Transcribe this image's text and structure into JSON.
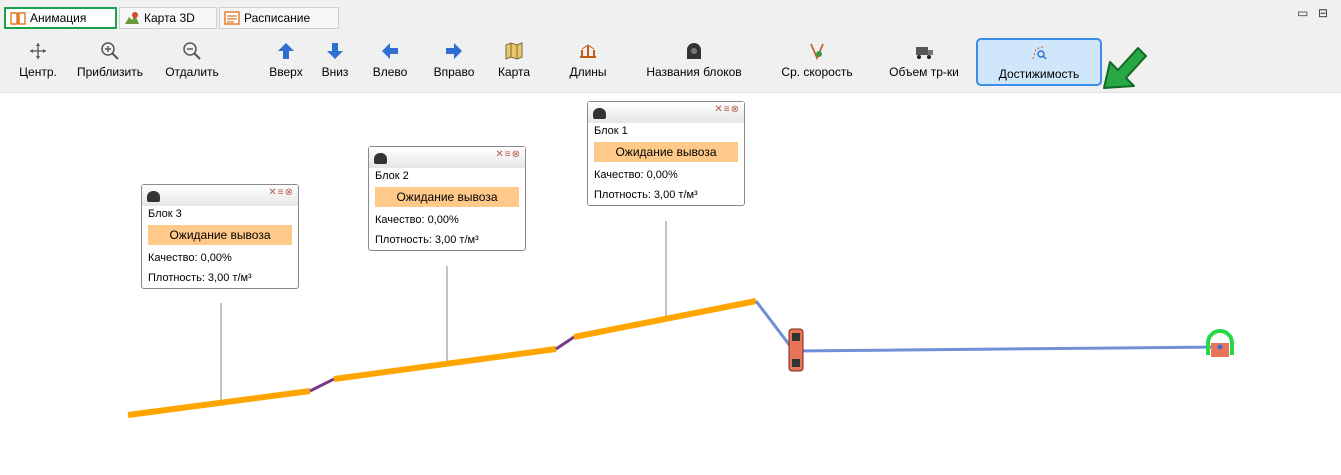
{
  "tabs": [
    {
      "label": "Анимация",
      "icon": "book-icon",
      "active": true
    },
    {
      "label": "Карта 3D",
      "icon": "map-3d-icon",
      "active": false
    },
    {
      "label": "Расписание",
      "icon": "schedule-icon",
      "active": false
    }
  ],
  "window_controls": {
    "minimize": "▭",
    "restore": "⊟"
  },
  "toolbar": [
    {
      "label": "Центр.",
      "icon": "move-center-icon"
    },
    {
      "label": "Приблизить",
      "icon": "zoom-in-icon"
    },
    {
      "label": "Отдалить",
      "icon": "zoom-out-icon"
    },
    {
      "label": "Вверх",
      "icon": "arrow-up-icon"
    },
    {
      "label": "Вниз",
      "icon": "arrow-down-icon"
    },
    {
      "label": "Влево",
      "icon": "arrow-left-icon"
    },
    {
      "label": "Вправо",
      "icon": "arrow-right-icon"
    },
    {
      "label": "Карта",
      "icon": "map-icon"
    },
    {
      "label": "Длины",
      "icon": "lengths-icon"
    },
    {
      "label": "Названия блоков",
      "icon": "block-names-icon"
    },
    {
      "label": "Ср. скорость",
      "icon": "avg-speed-icon"
    },
    {
      "label": "Объем тр-ки",
      "icon": "truck-volume-icon"
    },
    {
      "label": "Достижимость",
      "icon": "reachability-icon",
      "active": true
    }
  ],
  "blocks": [
    {
      "title": "Блок 3",
      "status": "Ожидание вывоза",
      "quality": "Качество: 0,00%",
      "density": "Плотность: 3,00 т/м³"
    },
    {
      "title": "Блок 2",
      "status": "Ожидание вывоза",
      "quality": "Качество: 0,00%",
      "density": "Плотность: 3,00 т/м³"
    },
    {
      "title": "Блок 1",
      "status": "Ожидание вывоза",
      "quality": "Качество: 0,00%",
      "density": "Плотность: 3,00 т/м³"
    }
  ],
  "colors": {
    "road": "#ffa500",
    "route": "#6f8fd6",
    "accent_green": "#1aa34a",
    "status_bg": "#ffc98a",
    "active_tb": "#cfe6fb"
  }
}
